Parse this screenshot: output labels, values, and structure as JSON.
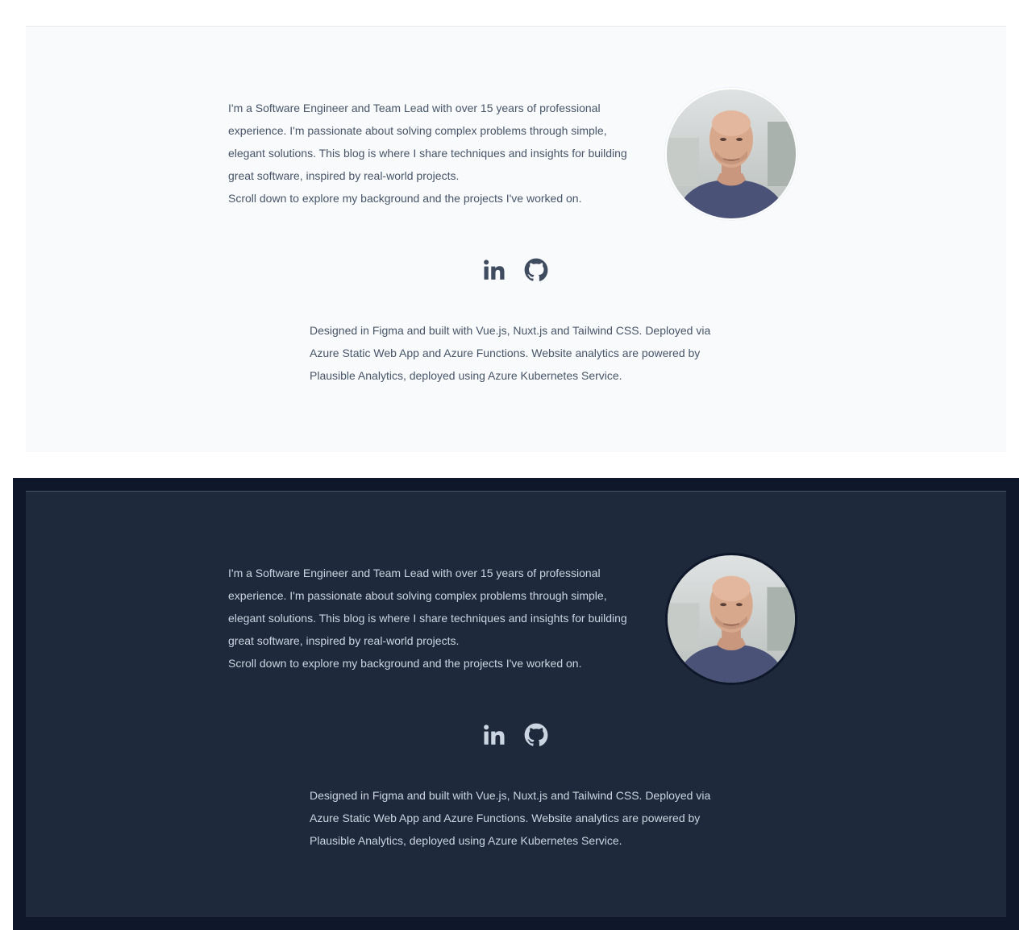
{
  "theme_light": {
    "bio": {
      "paragraph": "I'm a Software Engineer and Team Lead with over 15 years of professional experience. I'm passionate about solving complex problems through simple, elegant solutions. This blog is where I share techniques and insights for building great software, inspired by real-world projects.",
      "scroll_hint": "Scroll down to explore my background and the projects I've worked on."
    },
    "socials": [
      {
        "icon": "linkedin-icon"
      },
      {
        "icon": "github-icon"
      }
    ],
    "credits": "Designed in Figma and built with Vue.js, Nuxt.js and Tailwind CSS. Deployed via Azure Static Web App and Azure Functions. Website analytics are powered by Plausible Analytics, deployed using Azure Kubernetes Service."
  },
  "theme_dark": {
    "bio": {
      "paragraph": "I'm a Software Engineer and Team Lead with over 15 years of professional experience. I'm passionate about solving complex problems through simple, elegant solutions. This blog is where I share techniques and insights for building great software, inspired by real-world projects.",
      "scroll_hint": "Scroll down to explore my background and the projects I've worked on."
    },
    "socials": [
      {
        "icon": "linkedin-icon"
      },
      {
        "icon": "github-icon"
      }
    ],
    "credits": "Designed in Figma and built with Vue.js, Nuxt.js and Tailwind CSS. Deployed via Azure Static Web App and Azure Functions. Website analytics are powered by Plausible Analytics, deployed using Azure Kubernetes Service."
  },
  "colors": {
    "light_bg": "#f8fafc",
    "light_text": "#475569",
    "dark_outer_bg": "#0f172a",
    "dark_bg": "#1e293b",
    "dark_text": "#cbd5e1"
  }
}
